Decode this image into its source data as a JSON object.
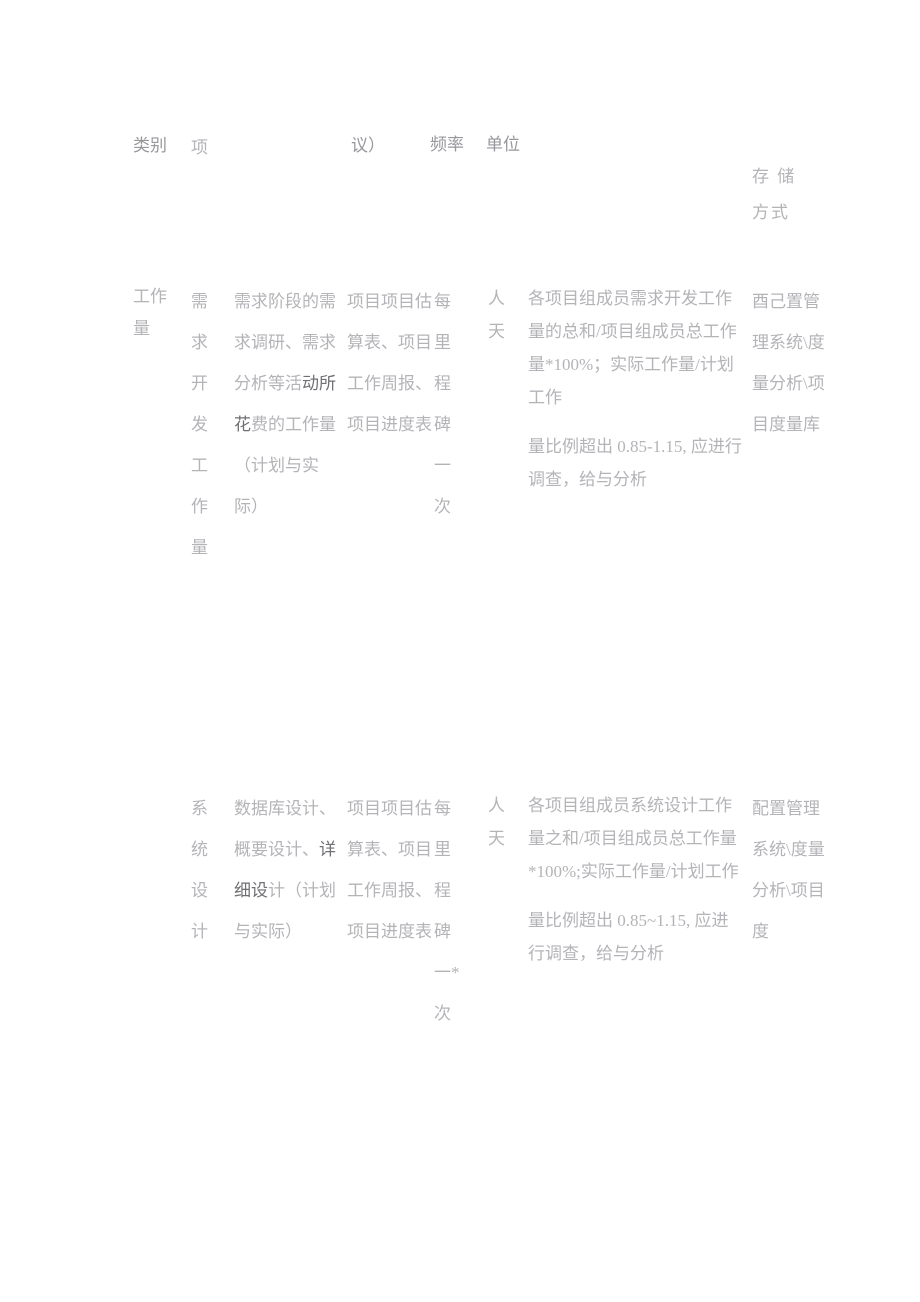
{
  "document": {
    "type": "table",
    "language": "zh-CN",
    "background_color": "#ffffff",
    "text_color": "#a9a9ad"
  },
  "table": {
    "headers": {
      "category": "类别",
      "item": "项",
      "description": "议）",
      "frequency": "频率",
      "unit": "单位",
      "storage_line1": "存 储",
      "storage_line2": "方式"
    },
    "rows": [
      {
        "category": "工作量",
        "item": "需求开发工作量",
        "description_part1": "需求阶段的需求调研、",
        "description_part2": "需求分析等活",
        "description_part3": "动所花",
        "description_part4": "费的工作量（计划与实际）",
        "source": "项目项目估算表、项目工作周报、项目进度表",
        "frequency": "每里程碑一次",
        "unit": "人天",
        "formula_part1": "各项目组成员需求开发工作量的总和/项目组成员总工作量*100%；实际工作量/计划工作",
        "formula_part2": "量比例超出 0.85-1.15, 应进行调查，给与分析",
        "storage": "酉己置管理系统\\度量分析\\项目度量库"
      },
      {
        "category": "",
        "item": "系统设计",
        "description_part1": "数据库设计、概要设计、",
        "description_part2": "",
        "description_part3": "详细设",
        "description_part4": "计（计划与实际）",
        "source": "项目项目估算表、项目工作周报、项目进度表",
        "frequency": "每里程碑一*次",
        "unit": "人天",
        "formula_part1": "各项目组成员系统设计工作量之和/项目组成员总工作量*100%;实际工作量/计划工作",
        "formula_part2": "量比例超出 0.85~1.15, 应进行调查，给与分析",
        "storage": "配置管理系统\\度量分析\\项目度"
      }
    ]
  }
}
